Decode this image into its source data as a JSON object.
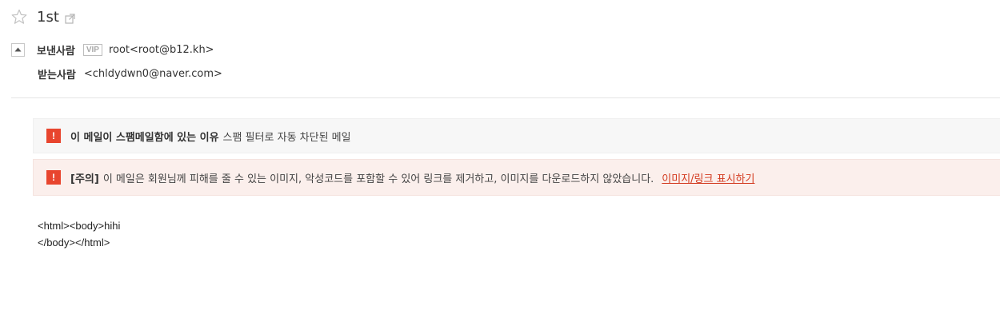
{
  "subject": {
    "title": "1st"
  },
  "sender": {
    "label": "보낸사람",
    "vip": "VIP",
    "value": "root<root@b12.kh>"
  },
  "receiver": {
    "label": "받는사람",
    "value": "<chldydwn0@naver.com>"
  },
  "spam_notice": {
    "icon": "!",
    "strong": "이 메일이 스팸메일함에 있는 이유",
    "text": "스팸 필터로 자동 차단된 메일"
  },
  "warning_notice": {
    "icon": "!",
    "strong": "[주의]",
    "text": "이 메일은 회원님께 피해를 줄 수 있는 이미지, 악성코드를 포함할 수 있어 링크를 제거하고, 이미지를 다운로드하지 않았습니다.",
    "link": "이미지/링크 표시하기"
  },
  "body": {
    "line1": "<html><body>hihi",
    "line2": "</body></html>"
  },
  "colors": {
    "alert": "#e8452e",
    "link": "#d33a1f",
    "warn_bg": "#fbefec",
    "spam_bg": "#f7f7f7"
  }
}
